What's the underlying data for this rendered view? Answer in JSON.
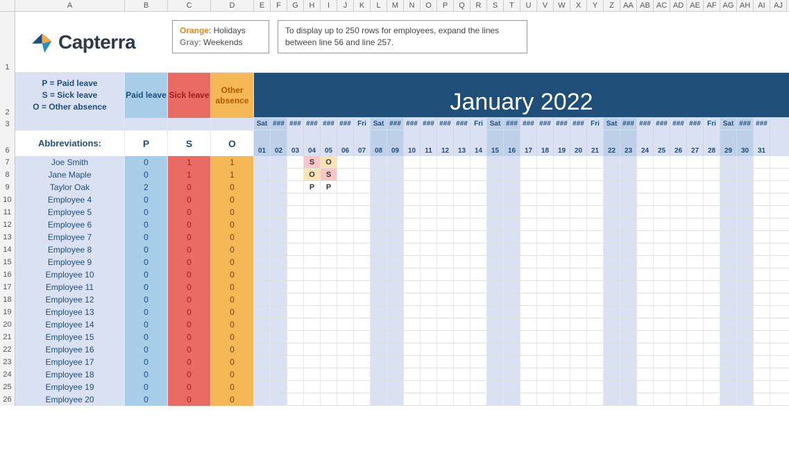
{
  "logo_text": "Capterra",
  "legend": {
    "orange_label": "Orange",
    "orange_value": "Holidays",
    "gray_label": "Gray",
    "gray_value": "Weekends"
  },
  "tip": "To display up to 250 rows for employees, expand the lines between line 56 and line 257.",
  "month_title": "January 2022",
  "abbr_lines": {
    "l1": "P = Paid leave",
    "l2": "S = Sick leave",
    "l3": "O = Other absence"
  },
  "abbr_title": "Abbreviations:",
  "col_paid": "Paid leave",
  "col_sick": "Sick leave",
  "col_other": "Other absence",
  "abbr_p": "P",
  "abbr_s": "S",
  "abbr_o": "O",
  "col_letters": [
    "A",
    "B",
    "C",
    "D",
    "E",
    "F",
    "G",
    "H",
    "I",
    "J",
    "K",
    "L",
    "M",
    "N",
    "O",
    "P",
    "Q",
    "R",
    "S",
    "T",
    "U",
    "V",
    "W",
    "X",
    "Y",
    "Z",
    "AA",
    "AB",
    "AC",
    "AD",
    "AE",
    "AF",
    "AG",
    "AH",
    "AI",
    "AJ"
  ],
  "row_numbers": [
    1,
    2,
    3,
    6,
    7,
    8,
    9,
    10,
    11,
    12,
    13,
    14,
    15,
    16,
    17,
    18,
    19,
    20,
    21,
    22,
    23,
    24,
    25,
    26
  ],
  "days": [
    {
      "n": "01",
      "h": "Sat",
      "wk": true
    },
    {
      "n": "02",
      "h": "###",
      "wk": true
    },
    {
      "n": "03",
      "h": "###",
      "wk": false
    },
    {
      "n": "04",
      "h": "###",
      "wk": false
    },
    {
      "n": "05",
      "h": "###",
      "wk": false
    },
    {
      "n": "06",
      "h": "###",
      "wk": false
    },
    {
      "n": "07",
      "h": "Fri",
      "wk": false
    },
    {
      "n": "08",
      "h": "Sat",
      "wk": true
    },
    {
      "n": "09",
      "h": "###",
      "wk": true
    },
    {
      "n": "10",
      "h": "###",
      "wk": false
    },
    {
      "n": "11",
      "h": "###",
      "wk": false
    },
    {
      "n": "12",
      "h": "###",
      "wk": false
    },
    {
      "n": "13",
      "h": "###",
      "wk": false
    },
    {
      "n": "14",
      "h": "Fri",
      "wk": false
    },
    {
      "n": "15",
      "h": "Sat",
      "wk": true
    },
    {
      "n": "16",
      "h": "###",
      "wk": true
    },
    {
      "n": "17",
      "h": "###",
      "wk": false
    },
    {
      "n": "18",
      "h": "###",
      "wk": false
    },
    {
      "n": "19",
      "h": "###",
      "wk": false
    },
    {
      "n": "20",
      "h": "###",
      "wk": false
    },
    {
      "n": "21",
      "h": "Fri",
      "wk": false
    },
    {
      "n": "22",
      "h": "Sat",
      "wk": true
    },
    {
      "n": "23",
      "h": "###",
      "wk": true
    },
    {
      "n": "24",
      "h": "###",
      "wk": false
    },
    {
      "n": "25",
      "h": "###",
      "wk": false
    },
    {
      "n": "26",
      "h": "###",
      "wk": false
    },
    {
      "n": "27",
      "h": "###",
      "wk": false
    },
    {
      "n": "28",
      "h": "Fri",
      "wk": false
    },
    {
      "n": "29",
      "h": "Sat",
      "wk": true
    },
    {
      "n": "30",
      "h": "###",
      "wk": true
    },
    {
      "n": "31",
      "h": "###",
      "wk": false
    }
  ],
  "employees": [
    {
      "name": "Joe Smith",
      "p": 0,
      "s": 1,
      "o": 1,
      "marks": {
        "04": "S",
        "05": "O"
      }
    },
    {
      "name": "Jane Maple",
      "p": 0,
      "s": 1,
      "o": 1,
      "marks": {
        "04": "O",
        "05": "S"
      }
    },
    {
      "name": "Taylor Oak",
      "p": 2,
      "s": 0,
      "o": 0,
      "marks": {
        "04": "P",
        "05": "P"
      }
    },
    {
      "name": "Employee 4",
      "p": 0,
      "s": 0,
      "o": 0,
      "marks": {}
    },
    {
      "name": "Employee 5",
      "p": 0,
      "s": 0,
      "o": 0,
      "marks": {}
    },
    {
      "name": "Employee 6",
      "p": 0,
      "s": 0,
      "o": 0,
      "marks": {}
    },
    {
      "name": "Employee 7",
      "p": 0,
      "s": 0,
      "o": 0,
      "marks": {}
    },
    {
      "name": "Employee 8",
      "p": 0,
      "s": 0,
      "o": 0,
      "marks": {}
    },
    {
      "name": "Employee 9",
      "p": 0,
      "s": 0,
      "o": 0,
      "marks": {}
    },
    {
      "name": "Employee 10",
      "p": 0,
      "s": 0,
      "o": 0,
      "marks": {}
    },
    {
      "name": "Employee 11",
      "p": 0,
      "s": 0,
      "o": 0,
      "marks": {}
    },
    {
      "name": "Employee 12",
      "p": 0,
      "s": 0,
      "o": 0,
      "marks": {}
    },
    {
      "name": "Employee 13",
      "p": 0,
      "s": 0,
      "o": 0,
      "marks": {}
    },
    {
      "name": "Employee 14",
      "p": 0,
      "s": 0,
      "o": 0,
      "marks": {}
    },
    {
      "name": "Employee 15",
      "p": 0,
      "s": 0,
      "o": 0,
      "marks": {}
    },
    {
      "name": "Employee 16",
      "p": 0,
      "s": 0,
      "o": 0,
      "marks": {}
    },
    {
      "name": "Employee 17",
      "p": 0,
      "s": 0,
      "o": 0,
      "marks": {}
    },
    {
      "name": "Employee 18",
      "p": 0,
      "s": 0,
      "o": 0,
      "marks": {}
    },
    {
      "name": "Employee 19",
      "p": 0,
      "s": 0,
      "o": 0,
      "marks": {}
    },
    {
      "name": "Employee 20",
      "p": 0,
      "s": 0,
      "o": 0,
      "marks": {}
    }
  ]
}
